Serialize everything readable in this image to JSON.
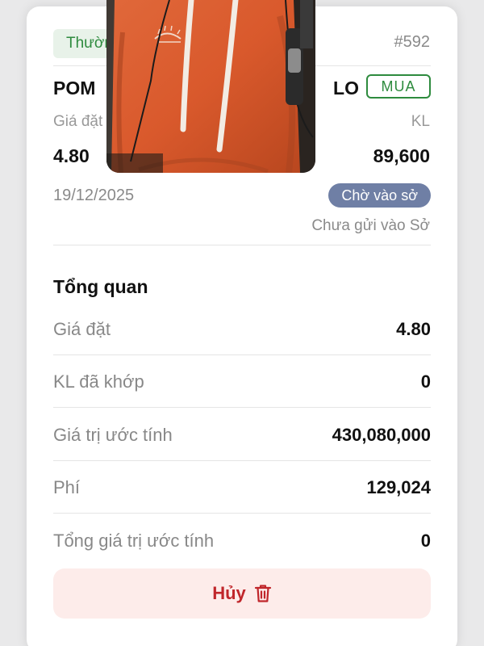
{
  "order": {
    "type_label": "Thường",
    "id": "#592",
    "symbol": "POM",
    "order_kind": "LO",
    "side": "MUA",
    "price_label": "Giá đặt",
    "price": "4.80",
    "qty_label": "KL",
    "qty": "89,600",
    "date": "19/12/2025",
    "status": "Chờ vào sở",
    "status_note": "Chưa gửi vào Sở"
  },
  "overview": {
    "title": "Tổng quan",
    "rows": [
      {
        "label": "Giá đặt",
        "value": "4.80"
      },
      {
        "label": "KL đã khớp",
        "value": "0"
      },
      {
        "label": "Giá trị ước tính",
        "value": "430,080,000"
      },
      {
        "label": "Phí",
        "value": "129,024"
      },
      {
        "label": "Tổng giá trị ước tính",
        "value": "0"
      }
    ]
  },
  "actions": {
    "cancel_label": "Hủy",
    "cancel_icon": "trash-icon"
  },
  "colors": {
    "buy_green": "#2e8b3e",
    "status_bg": "#6f7fa5",
    "cancel_red": "#c0262b",
    "cancel_bg": "#fdecea"
  }
}
